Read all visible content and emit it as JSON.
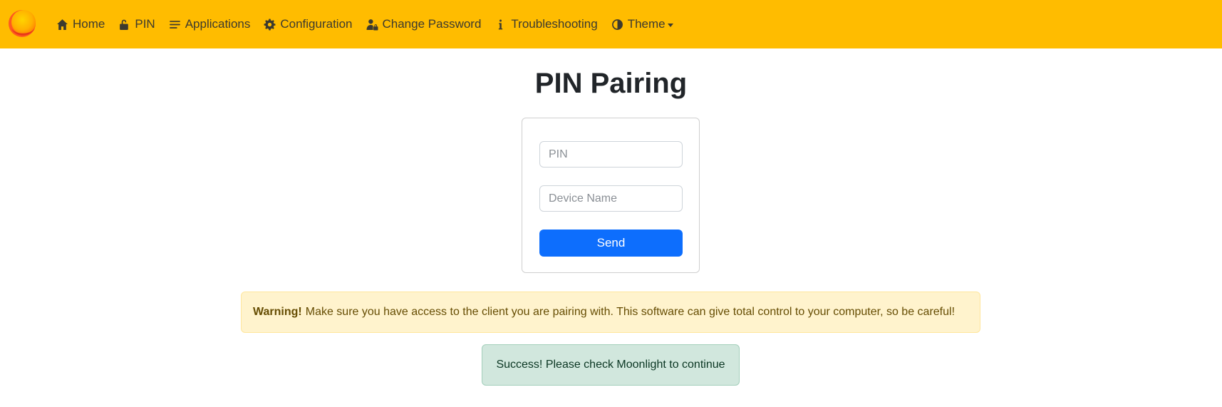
{
  "navbar": {
    "background": "#ffbc00",
    "logo_icon": "sun-logo-icon",
    "items": [
      {
        "label": "Home",
        "icon": "house-icon"
      },
      {
        "label": "PIN",
        "icon": "unlock-icon"
      },
      {
        "label": "Applications",
        "icon": "list-icon"
      },
      {
        "label": "Configuration",
        "icon": "gear-icon"
      },
      {
        "label": "Change Password",
        "icon": "user-lock-icon"
      },
      {
        "label": "Troubleshooting",
        "icon": "info-icon"
      },
      {
        "label": "Theme",
        "icon": "contrast-icon",
        "has_dropdown": true
      }
    ]
  },
  "main": {
    "title": "PIN Pairing",
    "form": {
      "pin_placeholder": "PIN",
      "pin_value": "",
      "device_placeholder": "Device Name",
      "device_value": "",
      "send_label": "Send",
      "send_color": "#0d6efd"
    },
    "warning": {
      "strong": "Warning!",
      "text": "Make sure you have access to the client you are pairing with. This software can give total control to your computer, so be careful!"
    },
    "success": {
      "text": "Success! Please check Moonlight to continue"
    }
  }
}
